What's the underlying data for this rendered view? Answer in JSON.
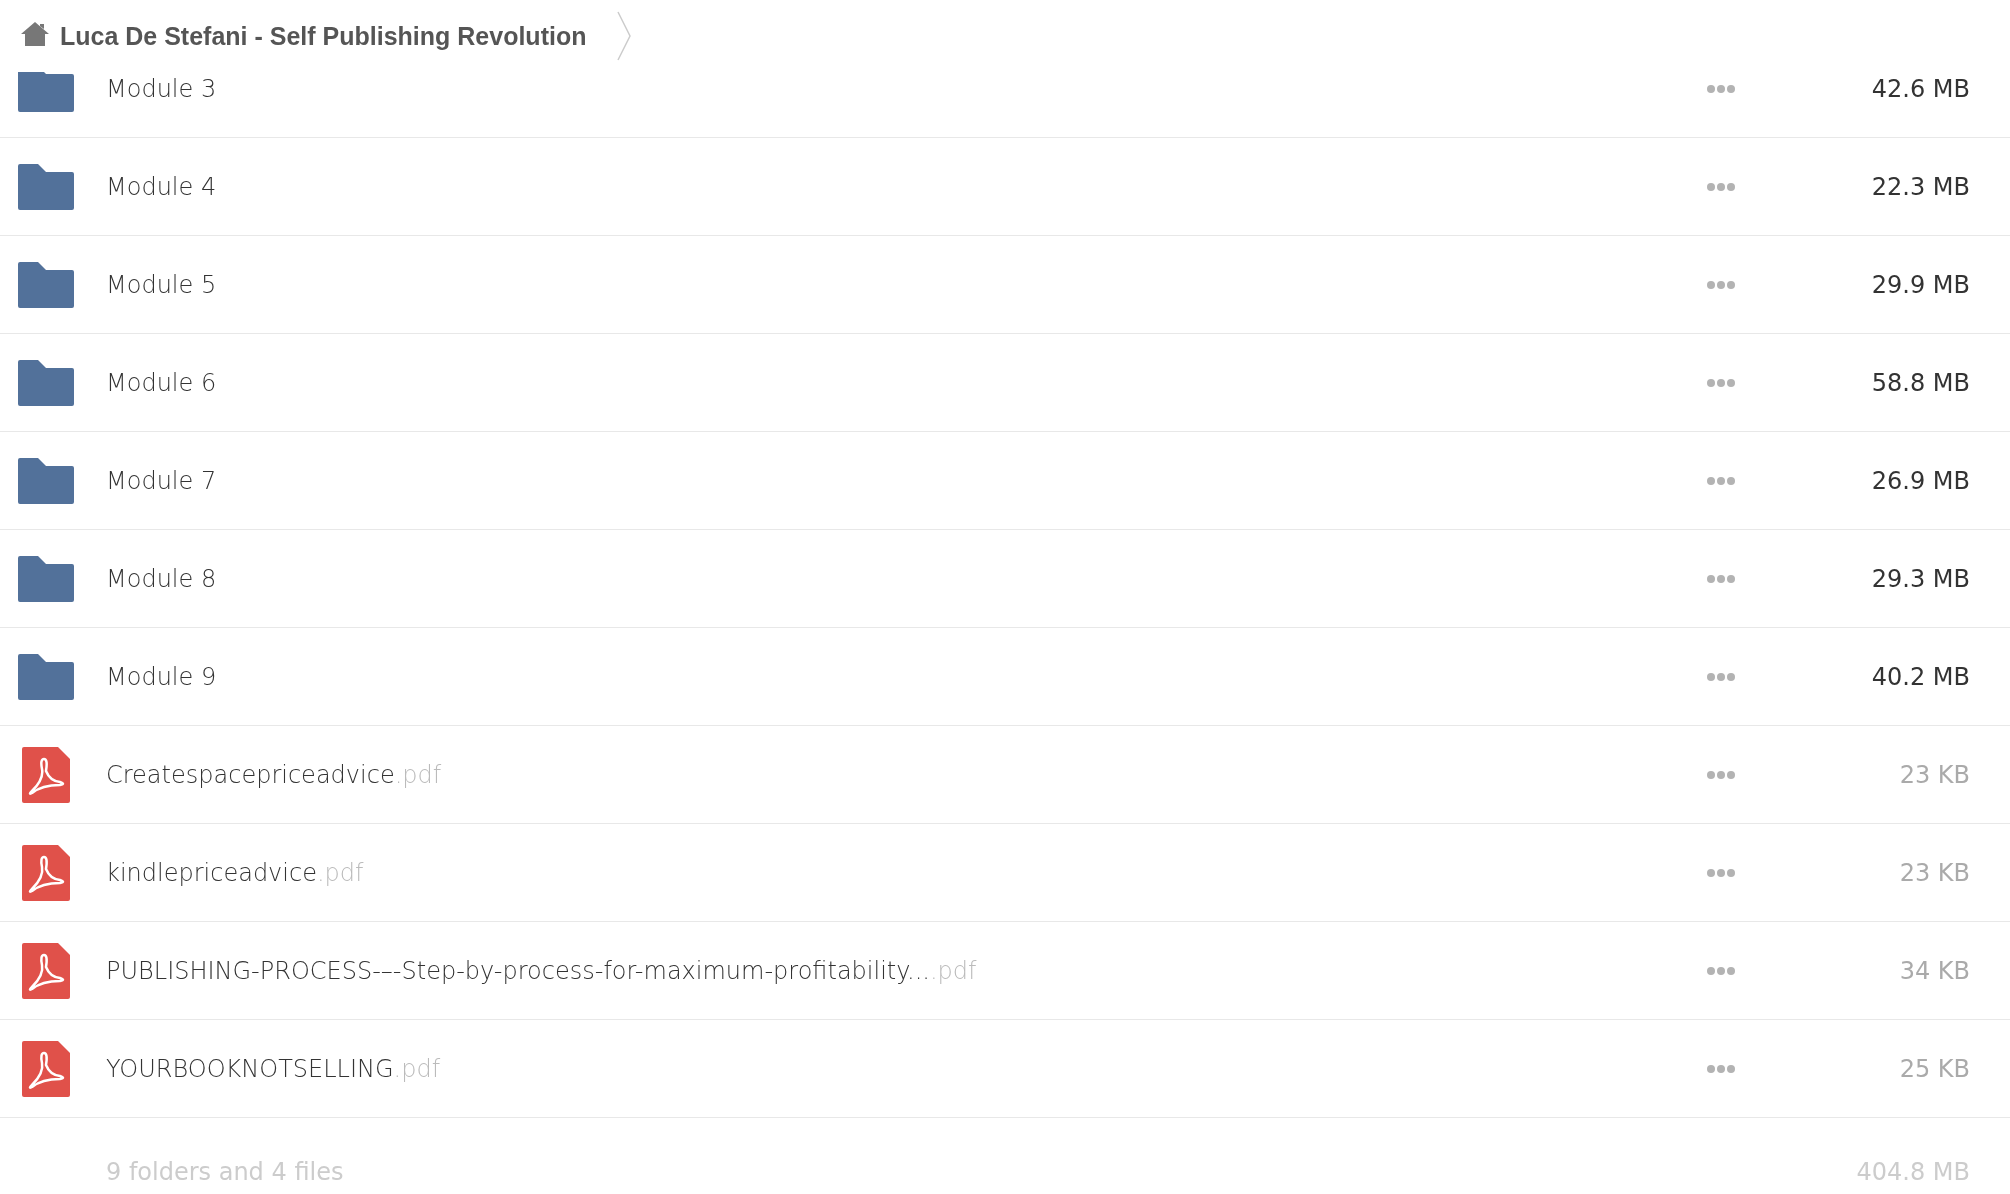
{
  "breadcrumb": {
    "title": "Luca De Stefani - Self Publishing Revolution"
  },
  "files": [
    {
      "kind": "folder",
      "name": "Module 3",
      "size": "42.6 MB"
    },
    {
      "kind": "folder",
      "name": "Module 4",
      "size": "22.3 MB"
    },
    {
      "kind": "folder",
      "name": "Module 5",
      "size": "29.9 MB"
    },
    {
      "kind": "folder",
      "name": "Module 6",
      "size": "58.8 MB"
    },
    {
      "kind": "folder",
      "name": "Module 7",
      "size": "26.9 MB"
    },
    {
      "kind": "folder",
      "name": "Module 8",
      "size": "29.3 MB"
    },
    {
      "kind": "folder",
      "name": "Module 9",
      "size": "40.2 MB"
    },
    {
      "kind": "pdf",
      "name": "Createspacepriceadvice",
      "extension": ".pdf",
      "size": "23 KB"
    },
    {
      "kind": "pdf",
      "name": "kindlepriceadvice",
      "extension": ".pdf",
      "size": "23 KB"
    },
    {
      "kind": "pdf",
      "name": "PUBLISHING-PROCESS-–-Step-by-process-for-maximum-profitability...",
      "extension": ".pdf",
      "size": "34 KB"
    },
    {
      "kind": "pdf",
      "name": "YOURBOOKNOTSELLING",
      "extension": ".pdf",
      "size": "25 KB"
    }
  ],
  "summary": {
    "count": "9 folders and 4 files",
    "total": "404.8 MB"
  }
}
